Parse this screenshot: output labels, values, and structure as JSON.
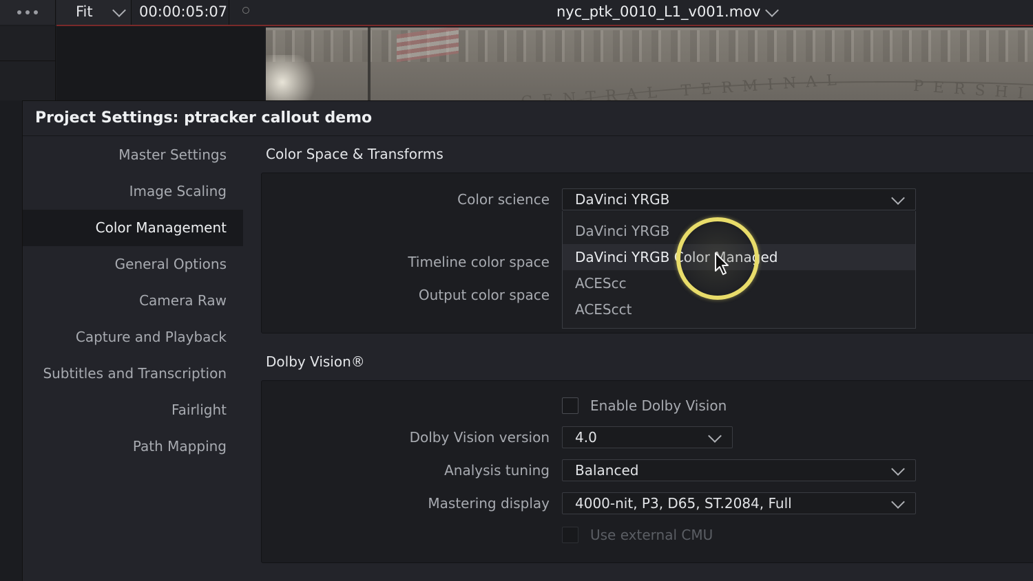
{
  "topbar": {
    "zoom": "Fit",
    "timecode": "00:00:05:07",
    "clip_name": "nyc_ptk_0010_L1_v001.mov"
  },
  "video": {
    "engraving_left": "CENTRAL TERMINAL",
    "engraving_right": "PERSHIN"
  },
  "dialog": {
    "title": "Project Settings:  ptracker callout demo",
    "nav": [
      {
        "label": "Master Settings"
      },
      {
        "label": "Image Scaling"
      },
      {
        "label": "Color Management",
        "active": true
      },
      {
        "label": "General Options"
      },
      {
        "label": "Camera Raw"
      },
      {
        "label": "Capture and Playback"
      },
      {
        "label": "Subtitles and Transcription"
      },
      {
        "label": "Fairlight"
      },
      {
        "label": "Path Mapping"
      }
    ],
    "color_space": {
      "heading": "Color Space & Transforms",
      "color_science_label": "Color science",
      "color_science_value": "DaVinci YRGB",
      "timeline_label": "Timeline color space",
      "output_label": "Output color space",
      "menu_options": [
        "DaVinci YRGB",
        "DaVinci YRGB Color Managed",
        "ACEScc",
        "ACEScct"
      ],
      "highlighted_option": "DaVinci YRGB Color Managed"
    },
    "dolby": {
      "heading": "Dolby Vision®",
      "enable_label": "Enable Dolby Vision",
      "version_label": "Dolby Vision version",
      "version_value": "4.0",
      "tuning_label": "Analysis tuning",
      "tuning_value": "Balanced",
      "mastering_label": "Mastering display",
      "mastering_value": "4000-nit, P3, D65, ST.2084, Full",
      "cmu_label": "Use external CMU"
    }
  },
  "colors": {
    "accent_ring": "#e8dc6a",
    "highlight_row": "#2b2c32"
  }
}
